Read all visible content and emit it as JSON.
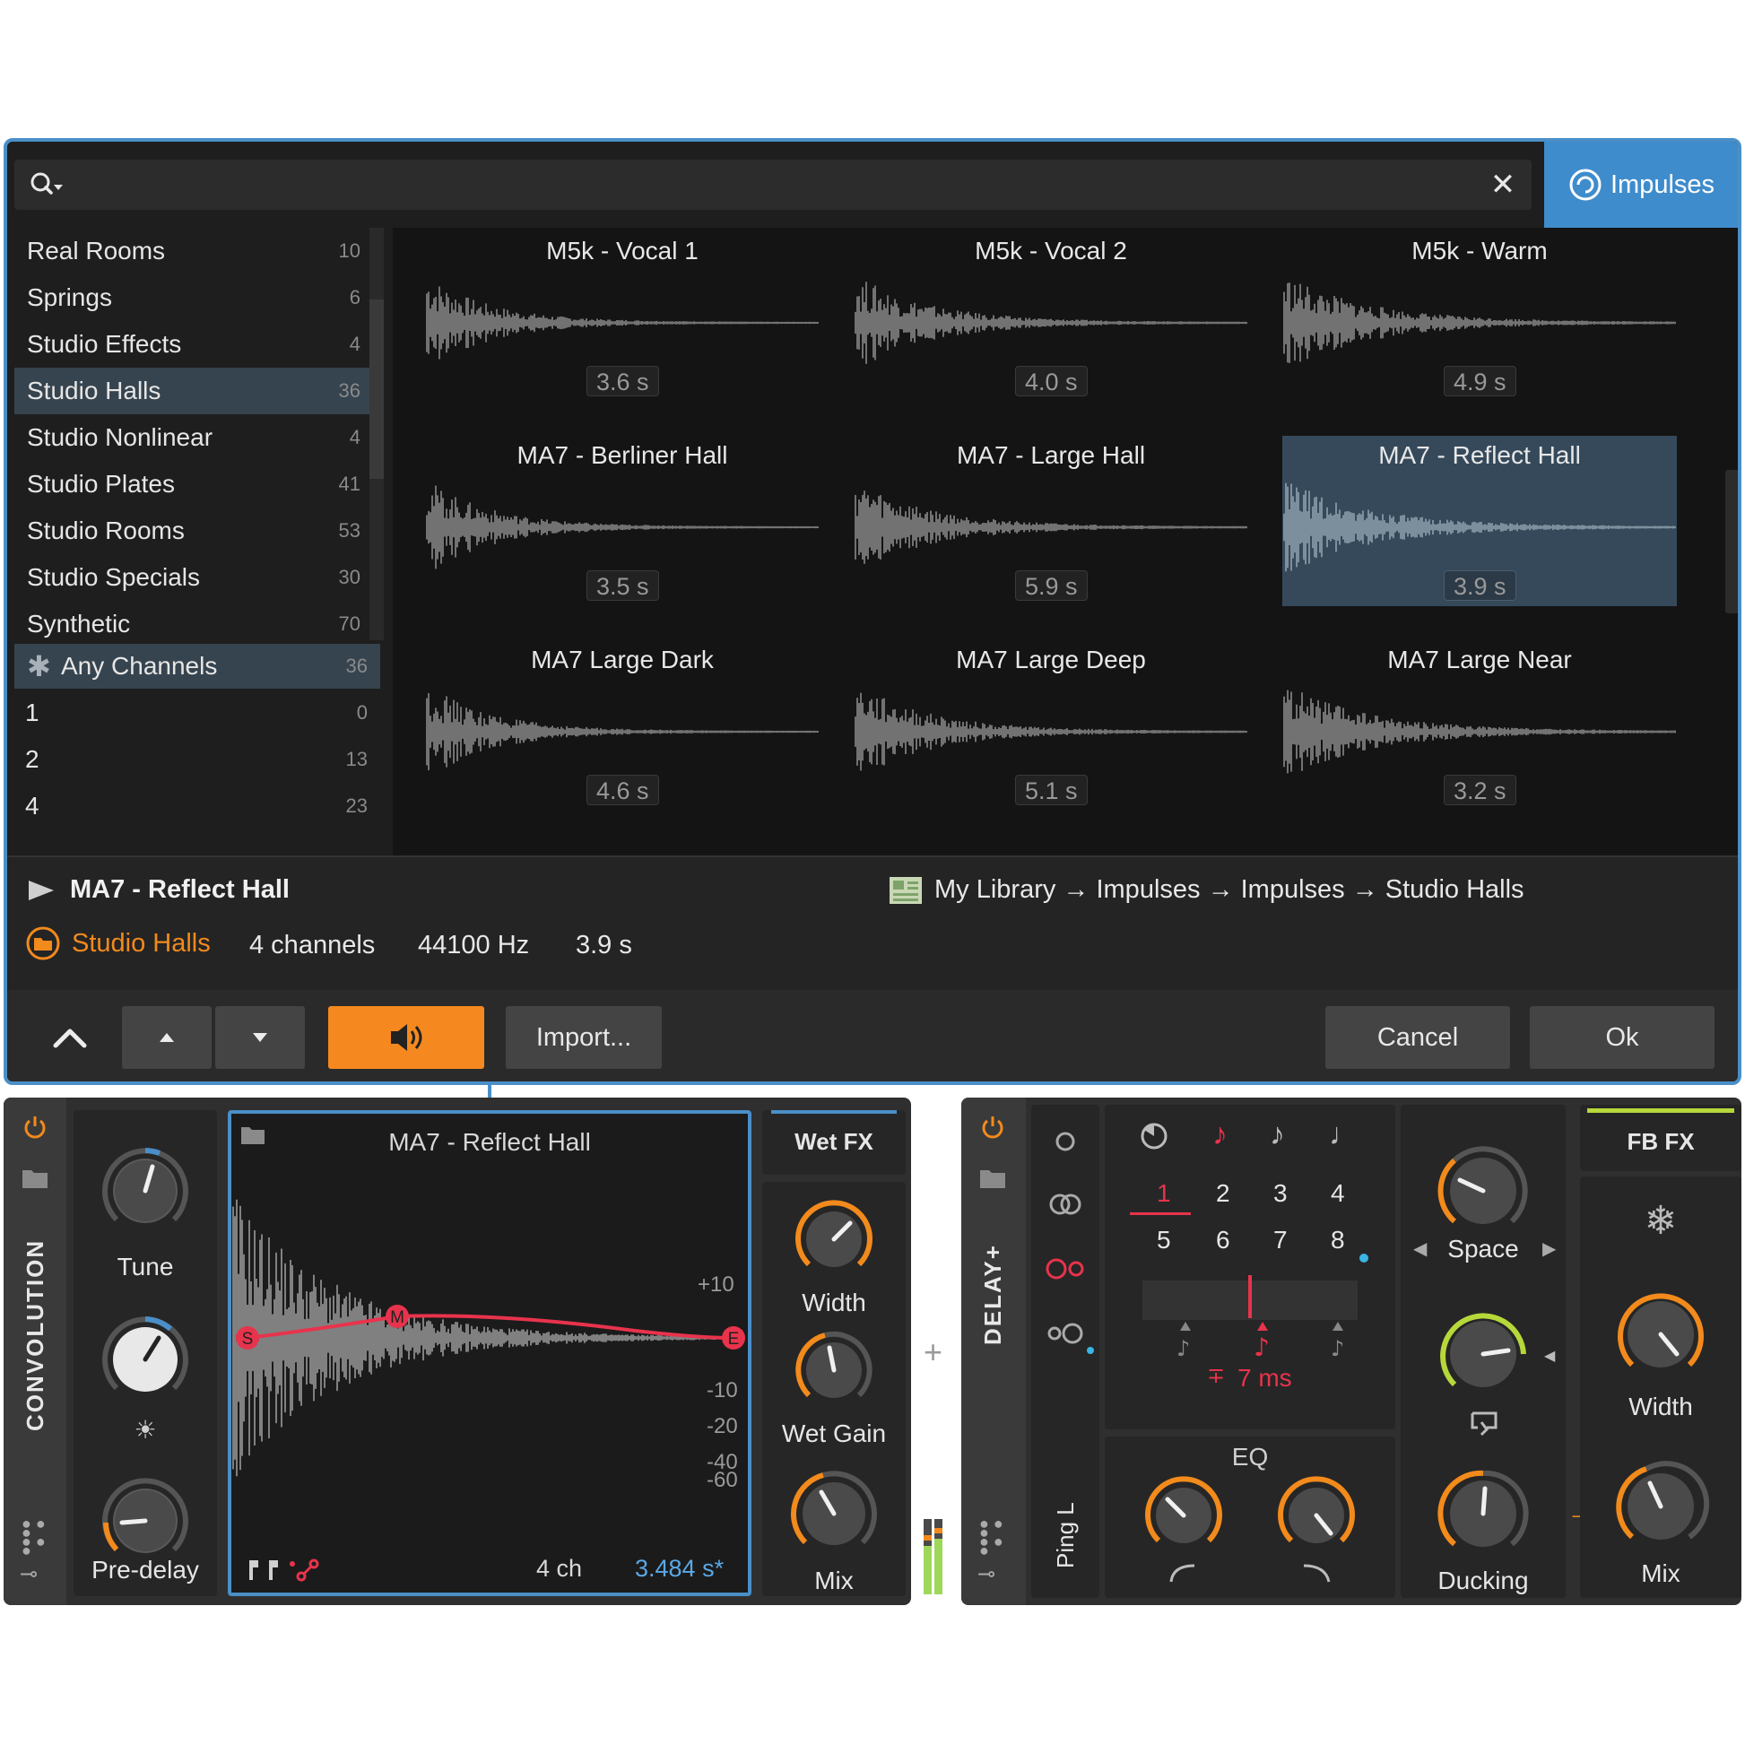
{
  "search": {
    "placeholder": "",
    "clear_icon": "close-icon"
  },
  "impulses_tab": {
    "label": "Impulses",
    "icon": "spiral-icon",
    "color": "#3f8ccc"
  },
  "categories": [
    {
      "label": "Real Rooms",
      "count": "10"
    },
    {
      "label": "Springs",
      "count": "6"
    },
    {
      "label": "Studio Effects",
      "count": "4"
    },
    {
      "label": "Studio Halls",
      "count": "36",
      "selected": true
    },
    {
      "label": "Studio Nonlinear",
      "count": "4"
    },
    {
      "label": "Studio Plates",
      "count": "41"
    },
    {
      "label": "Studio Rooms",
      "count": "53"
    },
    {
      "label": "Studio Specials",
      "count": "30"
    },
    {
      "label": "Synthetic",
      "count": "70"
    }
  ],
  "channels": [
    {
      "label": "Any Channels",
      "count": "36",
      "selected": true,
      "icon": "asterisk-icon"
    },
    {
      "label": "1",
      "count": "0"
    },
    {
      "label": "2",
      "count": "13"
    },
    {
      "label": "4",
      "count": "23"
    }
  ],
  "impulses": [
    {
      "name": "M5k - Vocal 1",
      "duration": "3.6 s"
    },
    {
      "name": "M5k - Vocal 2",
      "duration": "4.0 s"
    },
    {
      "name": "M5k - Warm",
      "duration": "4.9 s"
    },
    {
      "name": "MA7 - Berliner Hall",
      "duration": "3.5 s"
    },
    {
      "name": "MA7 - Large Hall",
      "duration": "5.9 s"
    },
    {
      "name": "MA7 - Reflect Hall",
      "duration": "3.9 s",
      "selected": true
    },
    {
      "name": "MA7 Large Dark",
      "duration": "4.6 s"
    },
    {
      "name": "MA7 Large Deep",
      "duration": "5.1 s"
    },
    {
      "name": "MA7 Large Near",
      "duration": "3.2 s"
    }
  ],
  "info": {
    "name": "MA7 - Reflect Hall",
    "path": "My Library → Impulses → Impulses → Studio Halls",
    "category": "Studio Halls",
    "channels": "4 channels",
    "sample_rate": "44100 Hz",
    "duration": "3.9 s"
  },
  "buttons": {
    "import": "Import...",
    "cancel": "Cancel",
    "ok": "Ok",
    "preview_color": "#f5891f"
  },
  "convolution": {
    "title": "CONVOLUTION",
    "tune_label": "Tune",
    "predelay_label": "Pre-delay",
    "ir_title": "MA7 - Reflect Hall",
    "ir_channels": "4 ch",
    "ir_length": "3.484 s*",
    "db_ticks": [
      "+10",
      "-10",
      "-20",
      "-40",
      "-60"
    ],
    "envelope_points": [
      "S",
      "M",
      "E"
    ],
    "wetfx_label": "Wet FX",
    "width_label": "Width",
    "wetgain_label": "Wet Gain",
    "mix_label": "Mix"
  },
  "delay": {
    "title": "DELAY+",
    "mode_label": "Ping L",
    "steps": [
      "1",
      "2",
      "3",
      "4",
      "5",
      "6",
      "7",
      "8"
    ],
    "offset": "7 ms",
    "eq_label": "EQ",
    "space_label": "Space",
    "ducking_label": "Ducking",
    "fbfx_label": "FB FX",
    "width_label": "Width",
    "mix_label": "Mix",
    "plus": "+"
  }
}
